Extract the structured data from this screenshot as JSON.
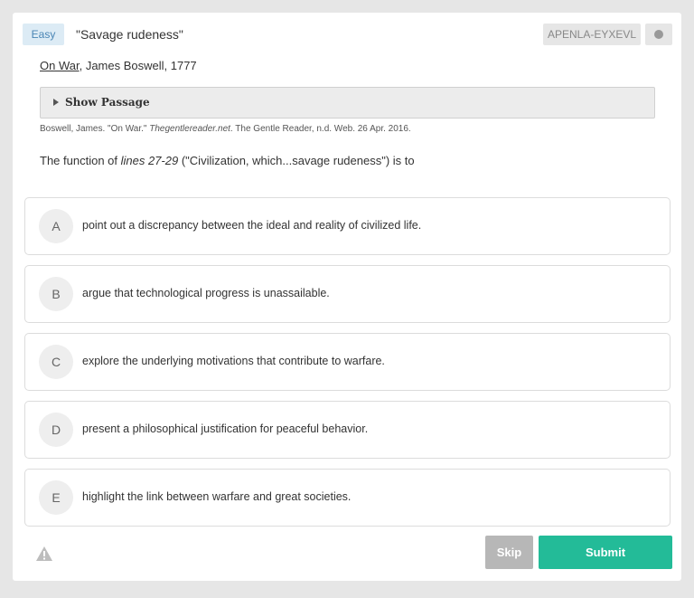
{
  "header": {
    "difficulty": "Easy",
    "question_title": "\"Savage rudeness\"",
    "question_id": "APENLA-EYXEVL"
  },
  "source": {
    "work": "On War",
    "author_year": ", James Boswell, 1777"
  },
  "passage_toggle": {
    "label": "Show Passage"
  },
  "citation": {
    "part1": "Boswell, James. \"On War.\" ",
    "site": "Thegentlereader.net",
    "part2": ". The Gentle Reader, n.d. Web. 26 Apr. 2016."
  },
  "prompt": {
    "before": "The function of ",
    "lines": "lines 27-29",
    "after": " (\"Civilization, which...savage rudeness\") is to"
  },
  "choices": [
    {
      "letter": "A",
      "text": "point out a discrepancy between the ideal and reality of civilized life."
    },
    {
      "letter": "B",
      "text": "argue that technological progress is unassailable."
    },
    {
      "letter": "C",
      "text": "explore the underlying motivations that contribute to warfare."
    },
    {
      "letter": "D",
      "text": "present a philosophical justification for peaceful behavior."
    },
    {
      "letter": "E",
      "text": "highlight the link between warfare and great societies."
    }
  ],
  "footer": {
    "skip_label": "Skip",
    "submit_label": "Submit",
    "report_icon": "warning-icon"
  },
  "colors": {
    "accent": "#23bb98",
    "difficulty_bg": "#dcebf5",
    "difficulty_text": "#4a86b5",
    "skip_bg": "#b7b7b7"
  }
}
